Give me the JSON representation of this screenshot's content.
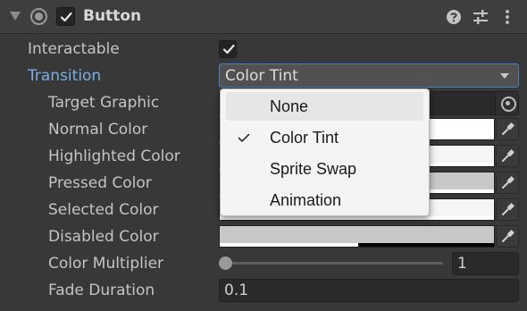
{
  "component": {
    "title": "Button",
    "enabled": true
  },
  "properties": {
    "interactable_label": "Interactable",
    "interactable_checked": true,
    "transition_label": "Transition",
    "transition_value": "Color Tint",
    "target_graphic_label": "Target Graphic",
    "normal_color_label": "Normal Color",
    "highlighted_color_label": "Highlighted Color",
    "pressed_color_label": "Pressed Color",
    "selected_color_label": "Selected Color",
    "disabled_color_label": "Disabled Color",
    "color_multiplier_label": "Color Multiplier",
    "color_multiplier_value": "1",
    "fade_duration_label": "Fade Duration",
    "fade_duration_value": "0.1"
  },
  "colors": {
    "normal": "#ffffff",
    "highlighted": "#f5f5f5",
    "pressed": "#c8c8c8",
    "selected": "#f5f5f5",
    "disabled": "#c8c8c8c",
    "disabled_alpha": 0.5,
    "accent_blue": "#7aaee6"
  },
  "color_multiplier_slider": {
    "min": 1,
    "max": 5,
    "value": 1
  },
  "transition_menu": {
    "options": [
      {
        "label": "None",
        "checked": false,
        "hover": true
      },
      {
        "label": "Color Tint",
        "checked": true,
        "hover": false
      },
      {
        "label": "Sprite Swap",
        "checked": false,
        "hover": false
      },
      {
        "label": "Animation",
        "checked": false,
        "hover": false
      }
    ]
  },
  "icons": {
    "fold": "triangle-down-icon",
    "component": "button-component-icon",
    "help": "help-icon",
    "presets": "presets-icon",
    "menu": "kebab-menu-icon",
    "picker": "object-picker-icon",
    "eyedropper": "eyedropper-icon",
    "check": "checkmark-icon"
  }
}
